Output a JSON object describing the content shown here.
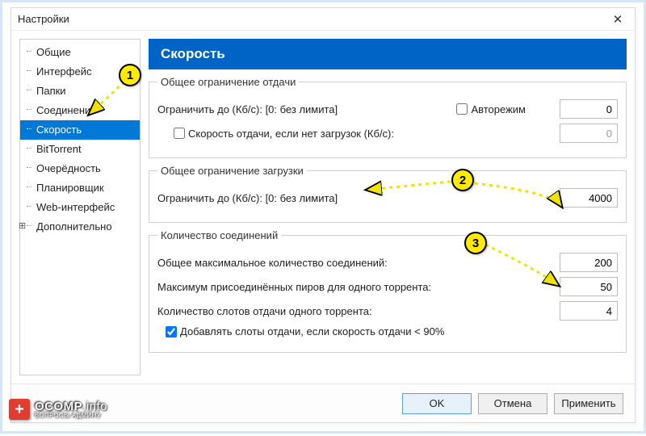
{
  "window": {
    "title": "Настройки"
  },
  "tree": {
    "items": [
      {
        "label": "Общие"
      },
      {
        "label": "Интерфейс"
      },
      {
        "label": "Папки"
      },
      {
        "label": "Соединение"
      },
      {
        "label": "Скорость",
        "selected": true
      },
      {
        "label": "BitTorrent"
      },
      {
        "label": "Очерёдность"
      },
      {
        "label": "Планировщик"
      },
      {
        "label": "Web-интерфейс"
      },
      {
        "label": "Дополнительно",
        "expandable": true
      }
    ]
  },
  "panel": {
    "header": "Скорость",
    "upload": {
      "legend": "Общее ограничение отдачи",
      "limit_label": "Ограничить до (Кб/с): [0: без лимита]",
      "auto_label": "Авторежим",
      "auto_checked": false,
      "limit_value": "0",
      "alt_label": "Скорость отдачи, если нет загрузок (Кб/с):",
      "alt_checked": false,
      "alt_value": "0"
    },
    "download": {
      "legend": "Общее ограничение загрузки",
      "limit_label": "Ограничить до (Кб/с): [0: без лимита]",
      "limit_value": "4000"
    },
    "connections": {
      "legend": "Количество соединений",
      "max_label": "Общее максимальное количество соединений:",
      "max_value": "200",
      "peers_label": "Максимум присоединённых пиров для одного торрента:",
      "peers_value": "50",
      "slots_label": "Количество слотов отдачи одного торрента:",
      "slots_value": "4",
      "addslots_label": "Добавлять слоты отдачи, если скорость отдачи < 90%",
      "addslots_checked": true
    }
  },
  "buttons": {
    "ok": "OK",
    "cancel": "Отмена",
    "apply": "Применить"
  },
  "annotations": {
    "m1": "1",
    "m2": "2",
    "m3": "3"
  },
  "watermark": {
    "brand": "OCOMP",
    "suffix": ".info",
    "sub": "ВОПРОСЫ АДМИНУ"
  }
}
